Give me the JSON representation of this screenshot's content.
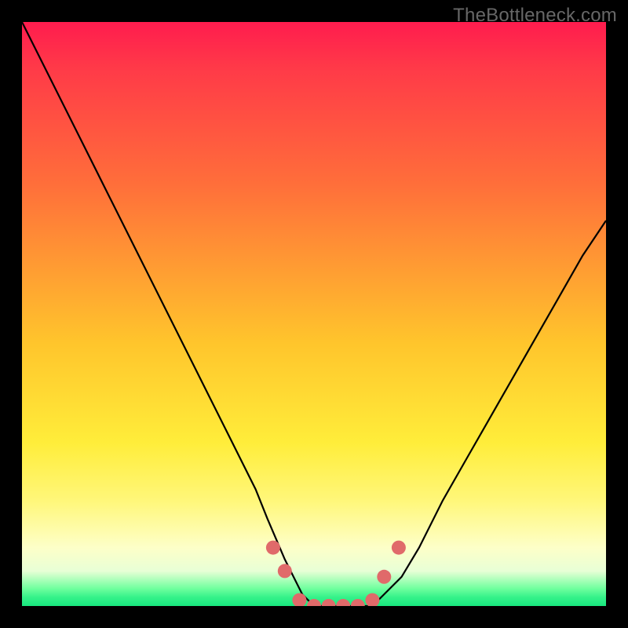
{
  "watermark": "TheBottleneck.com",
  "colors": {
    "frame": "#000000",
    "curve": "#000000",
    "marker_fill": "#e06a6a",
    "marker_stroke": "#cc4e4e",
    "watermark": "#676767",
    "gradient_top": "#ff1c4e",
    "gradient_bottom": "#18e87e"
  },
  "chart_data": {
    "type": "line",
    "title": "",
    "xlabel": "",
    "ylabel": "",
    "xlim": [
      0,
      100
    ],
    "ylim": [
      0,
      100
    ],
    "grid": false,
    "legend": false,
    "description": "V-shaped bottleneck curve over a vertical red→yellow→green gradient. Curve dips to a flat minimum near the bottom center; pink bead markers highlight the flat optimal segment and a few points on each rising side.",
    "series": [
      {
        "name": "bottleneck-curve",
        "x": [
          0,
          5,
          10,
          15,
          20,
          25,
          30,
          35,
          40,
          42,
          45,
          48,
          50,
          52,
          55,
          58,
          60,
          62,
          65,
          68,
          72,
          76,
          80,
          84,
          88,
          92,
          96,
          100
        ],
        "values": [
          100,
          90,
          80,
          70,
          60,
          50,
          40,
          30,
          20,
          15,
          8,
          2,
          0,
          0,
          0,
          0,
          0,
          2,
          5,
          10,
          18,
          25,
          32,
          39,
          46,
          53,
          60,
          66
        ]
      }
    ],
    "markers": {
      "name": "optimal-beads",
      "x": [
        43,
        45,
        47.5,
        50,
        52.5,
        55,
        57.5,
        60,
        62,
        64.5
      ],
      "values": [
        10,
        6,
        1,
        0,
        0,
        0,
        0,
        1,
        5,
        10
      ]
    }
  }
}
